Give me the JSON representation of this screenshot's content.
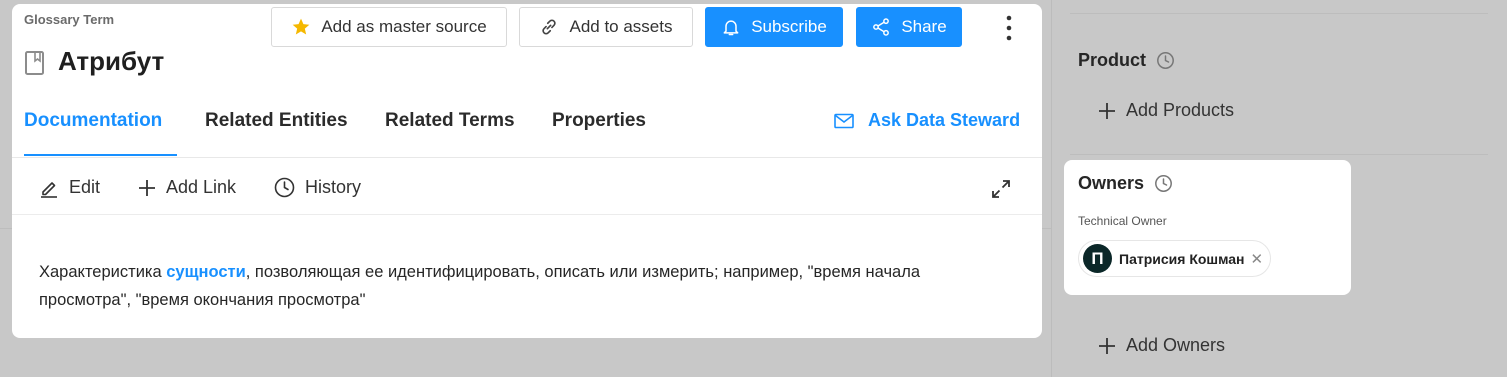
{
  "header": {
    "breadcrumb": "Glossary Term",
    "title": "Атрибут",
    "actions": {
      "master_source": "Add as master source",
      "assets": "Add to assets",
      "subscribe": "Subscribe",
      "share": "Share"
    }
  },
  "tabs": [
    {
      "label": "Documentation",
      "active": true
    },
    {
      "label": "Related Entities",
      "active": false
    },
    {
      "label": "Related Terms",
      "active": false
    },
    {
      "label": "Properties",
      "active": false
    }
  ],
  "ask_steward": "Ask Data Steward",
  "toolbar": {
    "edit": "Edit",
    "add_link": "Add Link",
    "history": "History"
  },
  "description": {
    "before": "Характеристика ",
    "link": "сущности",
    "after": ", позволяющая ее идентифицировать, описать или измерить; например, \"время начала просмотра\", \"время окончания просмотра\""
  },
  "sidebar": {
    "product": {
      "title": "Product",
      "add_label": "Add Products"
    },
    "owners": {
      "title": "Owners",
      "owner_type": "Technical Owner",
      "owner_name": "Патрисия Кошман",
      "owner_initial": "П",
      "add_label": "Add Owners"
    }
  },
  "colors": {
    "accent": "#1890ff",
    "overlay": "#c8c8c8",
    "avatar": "#0b2728",
    "star": "#f5b800"
  }
}
